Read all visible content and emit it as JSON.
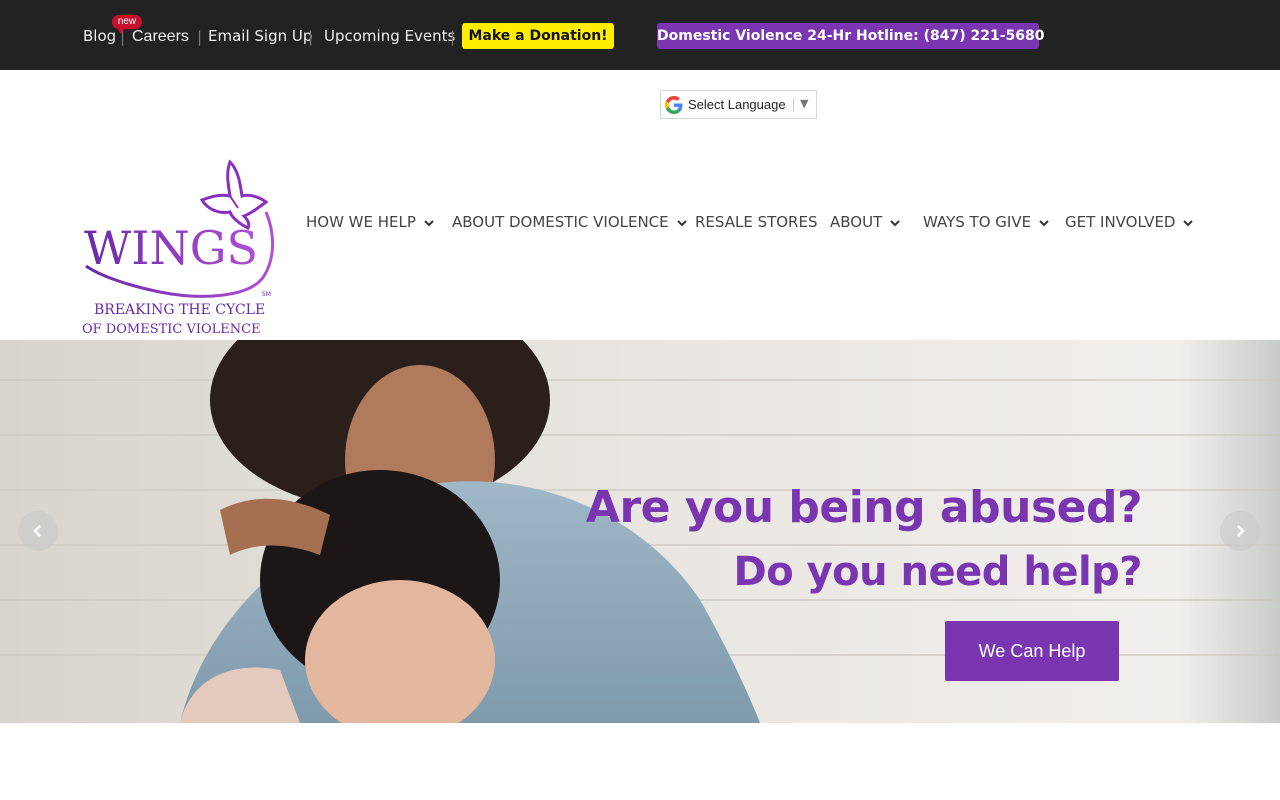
{
  "topbar": {
    "links": {
      "blog": "Blog",
      "careers": "Careers",
      "email_signup": "Email Sign Up",
      "events": "Upcoming Events"
    },
    "separator": "|",
    "new_badge": "new",
    "donate": "Make a Donation!",
    "hotline": "Domestic Violence 24-Hr Hotline: (847) 221-5680"
  },
  "language": {
    "label": "Select Language",
    "caret": "▼"
  },
  "logo": {
    "name": "WINGS",
    "tagline_1": "BREAKING THE CYCLE",
    "tagline_2": "OF DOMESTIC VIOLENCE",
    "mark": "SM"
  },
  "nav": {
    "how_we_help": "HOW WE HELP",
    "about_dv": "ABOUT DOMESTIC VIOLENCE",
    "resale": "RESALE STORES",
    "about": "ABOUT",
    "ways_to_give": "WAYS TO GIVE",
    "get_involved": "GET INVOLVED"
  },
  "hero": {
    "headline": "Are you being abused?",
    "subheadline": "Do you need help?",
    "cta": "We Can Help"
  },
  "colors": {
    "brand_purple": "#7a36b0",
    "donate_yellow": "#ffee00",
    "topbar": "#222222"
  }
}
